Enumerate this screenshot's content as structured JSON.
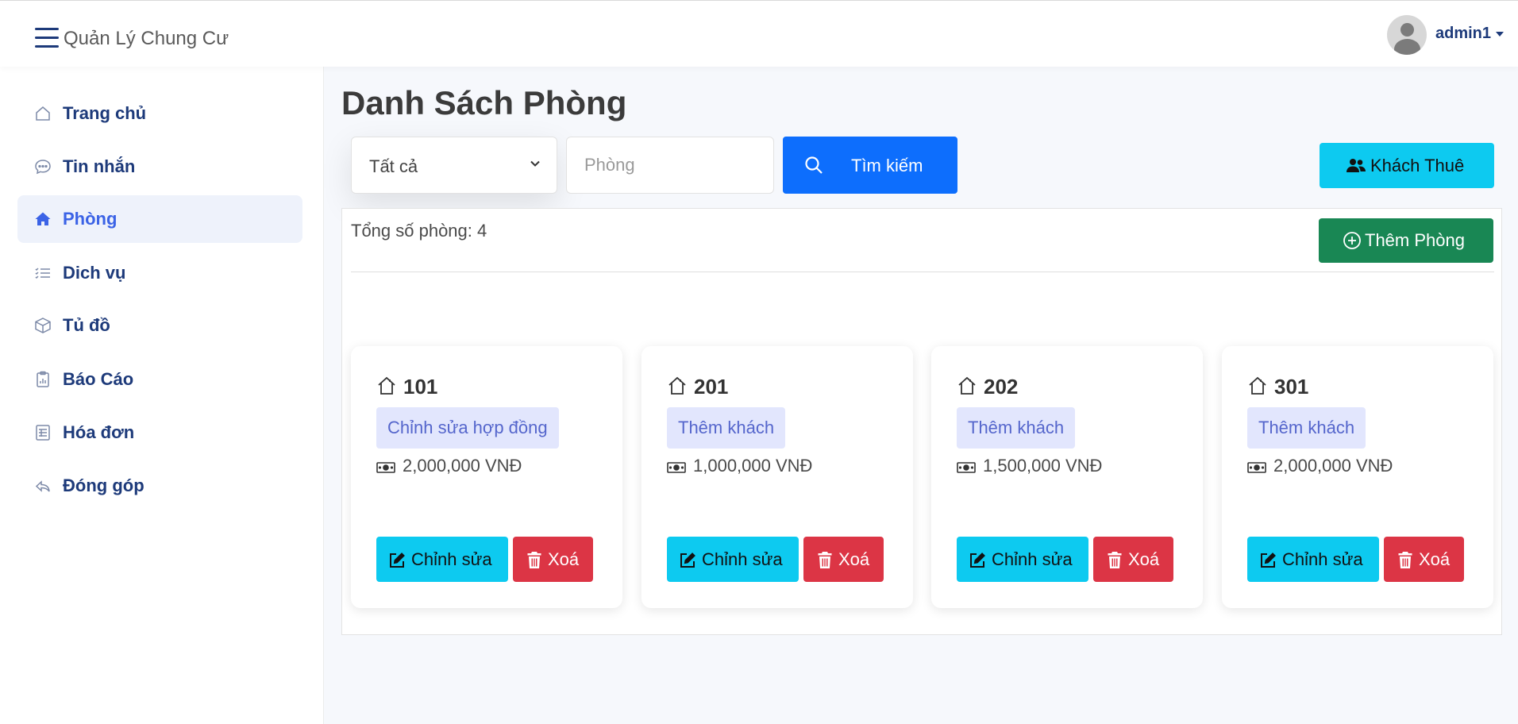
{
  "header": {
    "brand": "Quản Lý Chung Cư",
    "username": "admin1"
  },
  "sidebar": {
    "items": [
      {
        "label": "Trang chủ",
        "icon": "home-icon"
      },
      {
        "label": "Tin nhắn",
        "icon": "chat-icon"
      },
      {
        "label": "Phòng",
        "icon": "house-icon",
        "active": true
      },
      {
        "label": "Dich vụ",
        "icon": "list-icon"
      },
      {
        "label": "Tủ đồ",
        "icon": "box-icon"
      },
      {
        "label": "Báo Cáo",
        "icon": "report-icon"
      },
      {
        "label": "Hóa đơn",
        "icon": "invoice-icon"
      },
      {
        "label": "Đóng góp",
        "icon": "reply-icon"
      }
    ]
  },
  "main": {
    "title": "Danh Sách Phòng",
    "filter": {
      "selected": "Tất cả"
    },
    "search": {
      "placeholder": "Phòng",
      "button_label": "Tìm kiếm"
    },
    "tenants_button": "Khách Thuê",
    "total_label": "Tổng số phòng: 4",
    "add_room_button": "Thêm Phòng",
    "rooms": [
      {
        "number": "101",
        "action": "Chỉnh sửa hợp đồng",
        "price": "2,000,000 VNĐ",
        "edit_label": "Chỉnh sửa",
        "delete_label": "Xoá"
      },
      {
        "number": "201",
        "action": "Thêm khách",
        "price": "1,000,000 VNĐ",
        "edit_label": "Chỉnh sửa",
        "delete_label": "Xoá"
      },
      {
        "number": "202",
        "action": "Thêm khách",
        "price": "1,500,000 VNĐ",
        "edit_label": "Chỉnh sửa",
        "delete_label": "Xoá"
      },
      {
        "number": "301",
        "action": "Thêm khách",
        "price": "2,000,000 VNĐ",
        "edit_label": "Chỉnh sửa",
        "delete_label": "Xoá"
      }
    ]
  },
  "colors": {
    "primary": "#0d6efd",
    "info": "#0dcaf0",
    "success": "#198754",
    "danger": "#dc3545",
    "nav_text": "#1d3a7a",
    "nav_active": "#3b63e6"
  }
}
